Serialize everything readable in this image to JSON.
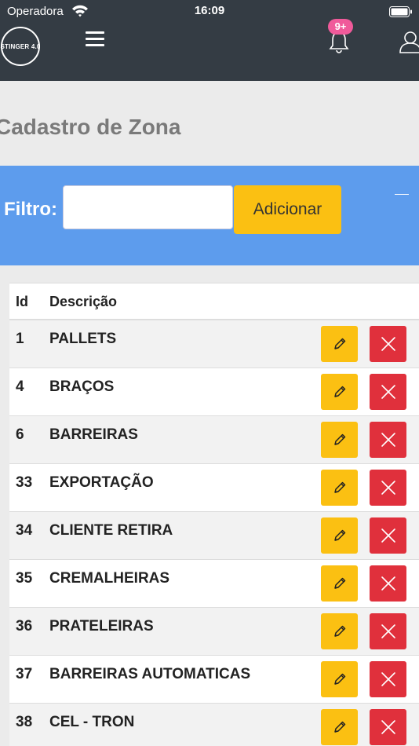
{
  "status_bar": {
    "carrier": "Operadora",
    "time": "16:09"
  },
  "header": {
    "logo_text": "STINGER 4.0",
    "notification_badge": "9+"
  },
  "page": {
    "title": "Cadastro de Zona"
  },
  "filter": {
    "label": "Filtro:",
    "value": "",
    "placeholder": "",
    "add_label": "Adicionar"
  },
  "table": {
    "headers": {
      "id": "Id",
      "description": "Descrição"
    },
    "rows": [
      {
        "id": "1",
        "description": "PALLETS"
      },
      {
        "id": "4",
        "description": "BRAÇOS"
      },
      {
        "id": "6",
        "description": "BARREIRAS"
      },
      {
        "id": "33",
        "description": "EXPORTAÇÃO"
      },
      {
        "id": "34",
        "description": "CLIENTE RETIRA"
      },
      {
        "id": "35",
        "description": "CREMALHEIRAS"
      },
      {
        "id": "36",
        "description": "PRATELEIRAS"
      },
      {
        "id": "37",
        "description": "BARREIRAS AUTOMATICAS"
      },
      {
        "id": "38",
        "description": "CEL - TRON"
      }
    ]
  },
  "colors": {
    "topbar": "#343c44",
    "filter_panel": "#5d9ced",
    "edit_button": "#fbc012",
    "delete_button": "#e0303c",
    "badge": "#f05a9a"
  },
  "icons": {
    "menu": "hamburger-icon",
    "notifications": "bell-icon",
    "user": "user-icon",
    "edit": "pencil-icon",
    "delete": "close-icon",
    "collapse": "minus-icon"
  }
}
